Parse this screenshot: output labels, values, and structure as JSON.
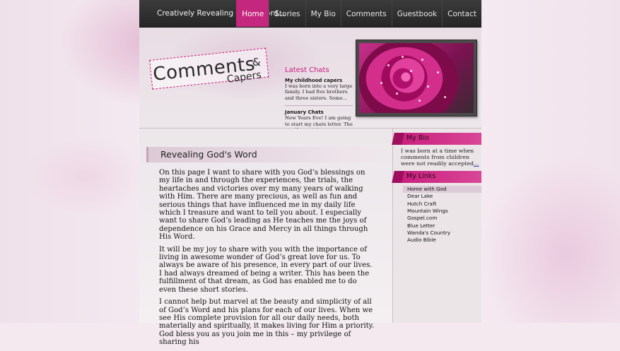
{
  "site": {
    "tagline": "Creatively Revealing God's Word..."
  },
  "nav": {
    "items": [
      {
        "label": "Home",
        "active": true
      },
      {
        "label": "Stories",
        "active": false
      },
      {
        "label": "My Bio",
        "active": false
      },
      {
        "label": "Comments",
        "active": false
      },
      {
        "label": "Guestbook",
        "active": false
      },
      {
        "label": "Contact",
        "active": false
      }
    ]
  },
  "logo": {
    "main": "Comments",
    "amp": "&",
    "sub": "Capers"
  },
  "latest_chats": {
    "title": "Latest Chats",
    "items": [
      {
        "title": "My childhood capers",
        "excerpt": "I was born into a very large family. I had five brothers and three sisters. Some..."
      },
      {
        "title": "January Chats",
        "excerpt": "New Years Eve!  I am going to start my chats letter. The weather outsi..."
      }
    ]
  },
  "post": {
    "title": "Revealing God's Word",
    "paragraphs": [
      "On this page I want to share with you God’s blessings on my life in and through the experiences, the trials, the heartaches and victories over my many years of walking with Him. There are many precious, as well as fun and serious things that have influenced me in my daily life which I treasure and want to tell you about. I especially want to share God’s leading as He teaches me the joys of dependence on his Grace and Mercy in all things through His Word.",
      "It will be my joy to share with you with the importance of living in awesome wonder of God’s great love for us. To always be aware of his presence, in every part of our lives. I had always dreamed of being a writer. This has been the fulfillment of that dream, as God has enabled me to do even these short stories.",
      "I cannot help but marvel at the beauty and simplicity of all of God’s Word and his plans for each of our lives. When we see His complete provision for all our daily needs, both materially and spiritually, it makes living for Him a priority. God bless you as you join me in this – my privilege of sharing his"
    ]
  },
  "sidebar": {
    "bio": {
      "heading": "My Bio",
      "text": "I was born at a time when comments from children were not readily accepted",
      "more": "..."
    },
    "links": {
      "heading": "My Links",
      "items": [
        {
          "label": "Home with God",
          "active": true
        },
        {
          "label": "Dear Lake",
          "active": false
        },
        {
          "label": "Hutch Craft",
          "active": false
        },
        {
          "label": "Mountain Wings",
          "active": false
        },
        {
          "label": "Gospel.com",
          "active": false
        },
        {
          "label": "Blue Letter",
          "active": false
        },
        {
          "label": "Wanda's Country",
          "active": false
        },
        {
          "label": "Audio Bible",
          "active": false
        }
      ]
    }
  },
  "colors": {
    "accent": "#c81c7b",
    "topbar": "#2b2b2b",
    "link": "#2a3fb0"
  }
}
